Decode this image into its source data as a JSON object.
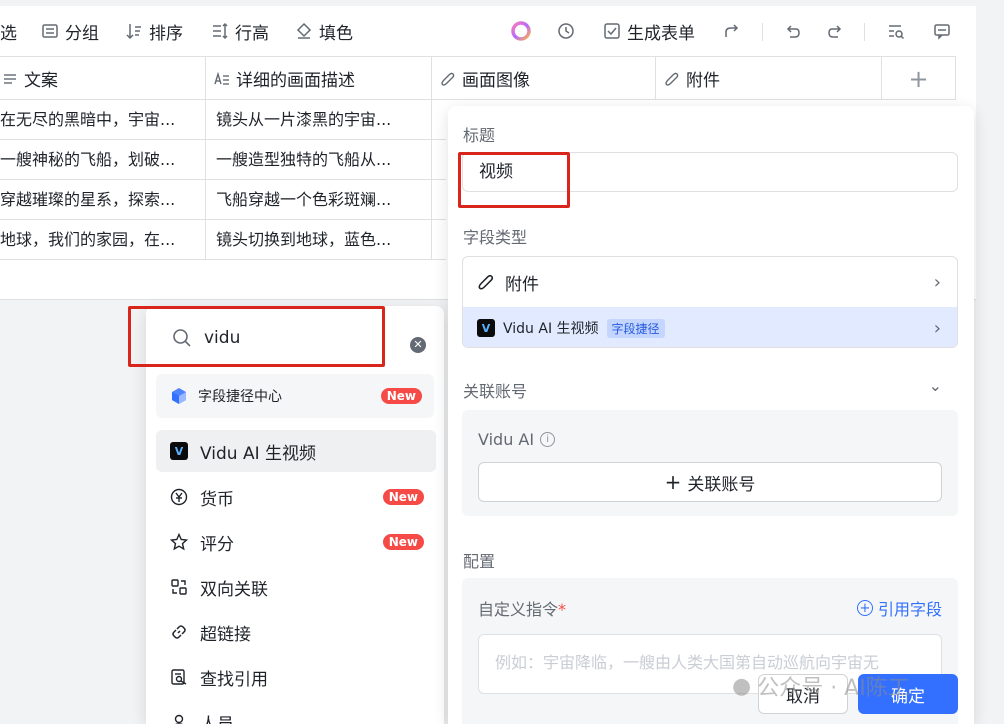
{
  "toolbar": {
    "filter_label": "选",
    "group_label": "分组",
    "sort_label": "排序",
    "row_height_label": "行高",
    "fill_label": "填色",
    "generate_form_label": "生成表单"
  },
  "table": {
    "columns": [
      "文案",
      "详细的画面描述",
      "画面图像",
      "附件"
    ],
    "rows": [
      [
        "在无尽的黑暗中，宇宙...",
        "镜头从一片漆黑的宇宙..."
      ],
      [
        "一艘神秘的飞船，划破...",
        "一艘造型独特的飞船从..."
      ],
      [
        "穿越璀璨的星系，探索...",
        "飞船穿越一个色彩斑斓..."
      ],
      [
        "地球，我们的家园，在...",
        "镜头切换到地球，蓝色..."
      ]
    ]
  },
  "dropdown": {
    "search_value": "vidu",
    "hub_label": "字段捷径中心",
    "new_badge": "New",
    "items": [
      {
        "label": "Vidu AI 生视频",
        "icon": "vidu-logo-icon",
        "selected": true,
        "new": false
      },
      {
        "label": "货币",
        "icon": "currency-icon",
        "selected": false,
        "new": true
      },
      {
        "label": "评分",
        "icon": "star-icon",
        "selected": false,
        "new": true
      },
      {
        "label": "双向关联",
        "icon": "two-way-link-icon",
        "selected": false,
        "new": false
      },
      {
        "label": "超链接",
        "icon": "hyperlink-icon",
        "selected": false,
        "new": false
      },
      {
        "label": "查找引用",
        "icon": "lookup-icon",
        "selected": false,
        "new": false
      },
      {
        "label": "人员",
        "icon": "person-icon",
        "selected": false,
        "new": false
      }
    ]
  },
  "panel": {
    "title_label": "标题",
    "title_value": "视频",
    "field_type_label": "字段类型",
    "field_type_value": "附件",
    "shortcut_name": "Vidu AI 生视频",
    "shortcut_tag": "字段捷径",
    "account_label": "关联账号",
    "account_service": "Vidu AI",
    "link_account_button": "关联账号",
    "config_label": "配置",
    "custom_prompt_label": "自定义指令",
    "required_mark": "*",
    "reference_field_link": "引用字段",
    "prompt_placeholder": "例如：宇宙降临，一艘由人类大国第自动巡航向宇宙无",
    "cancel_button": "取消",
    "ok_button": "确定"
  },
  "watermark": "公众号 · AI陈工",
  "colors": {
    "accent": "#3370ff",
    "highlight_box": "#d9261c",
    "new_badge": "#f54a45",
    "selected_row": "#e1eaff"
  }
}
